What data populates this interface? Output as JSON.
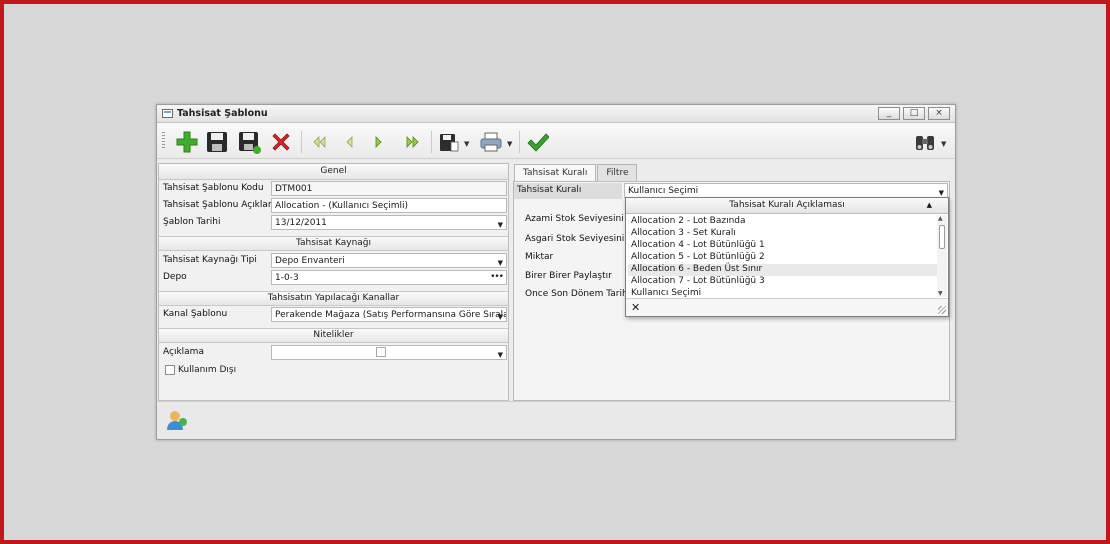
{
  "window": {
    "title": "Tahsisat Şablonu",
    "minimize": "_",
    "maximize": "□",
    "close": "×"
  },
  "toolbar": {
    "icons": [
      "add-icon",
      "save-icon",
      "save-as-icon",
      "delete-icon",
      "first-icon",
      "prev-icon",
      "next-icon",
      "last-icon",
      "export-icon",
      "print-icon",
      "confirm-icon",
      "binoculars-icon"
    ],
    "colors": {
      "add": "#3fae2a",
      "delete": "#d8262b",
      "nav": "#9acd3a",
      "confirm": "#3aa12e"
    }
  },
  "genel": {
    "header": "Genel",
    "kodu_label": "Tahsisat Şablonu Kodu",
    "kodu_value": "DTM001",
    "aciklama_label": "Tahsisat Şablonu Açıklaması",
    "aciklama_value": "Allocation  -  (Kullanıcı Seçimli)",
    "tarih_label": "Şablon Tarihi",
    "tarih_value": "13/12/2011"
  },
  "kaynak": {
    "header": "Tahsisat Kaynağı",
    "tip_label": "Tahsisat Kaynağı Tipi",
    "tip_value": "Depo Envanteri",
    "depo_label": "Depo",
    "depo_value": "1-0-3"
  },
  "kanallar": {
    "header": "Tahsisatın Yapılacağı Kanallar",
    "kanal_label": "Kanal Şablonu",
    "kanal_value": "Perakende Mağaza (Satış Performansına Göre Sıralanmış)"
  },
  "nitelikler": {
    "header": "Nitelikler",
    "aciklama_label": "Açıklama",
    "kullanim_label": "Kullanım Dışı"
  },
  "tabs": [
    "Tahsisat Kuralı",
    "Filtre"
  ],
  "kural": {
    "label": "Tahsisat Kuralı",
    "value": "Kullanıcı Seçimi",
    "rows": [
      "Azami Stok Seviyesini Dikkate Al",
      "Asgari Stok Seviyesini Dikkate Al",
      "Miktar",
      "Birer Birer Paylaştır",
      "Önce Son Dönem Tarihçesi"
    ]
  },
  "popup": {
    "header": "Tahsisat Kuralı Açıklaması",
    "items": [
      "Allocation 2 - Lot Bazında",
      "Allocation 3 - Set Kuralı",
      "Allocation 4 - Lot Bütünlüğü 1",
      "Allocation 5 - Lot Bütünlüğü 2",
      "Allocation 6 - Beden Üst Sınır",
      "Allocation 7 - Lot Bütünlüğü 3",
      "Kullanıcı Seçimi"
    ],
    "highlighted": 4
  }
}
